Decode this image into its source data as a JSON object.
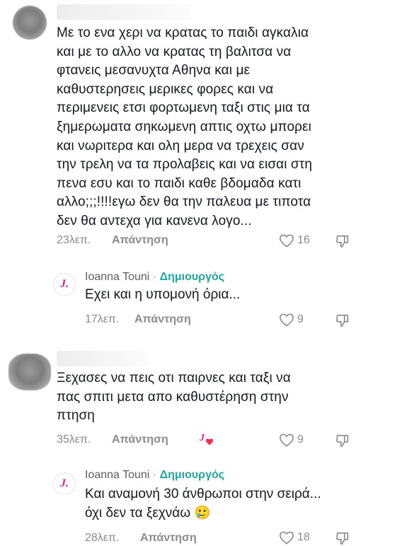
{
  "comments": [
    {
      "text": "Με το ενα χερι να κρατας το παιδι αγκαλια\nκαι με το αλλο να κρατας τη βαλιτσα να\nφτανεις μεσανυχτα Αθηνα και με\nκαθυστερησεις μερικες φορες και να\nπεριμενεις ετσι φορτωμενη ταξι στις μια τα\nξημερωματα σηκωμενη απτις οχτω μπορει\nκαι νωριτερα και ολη μερα να τρεχεις σαν\nτην τρελη να τα προλαβεις και να εισαι στη\nπενα εσυ και το παιδι καθε βδομαδα κατι\nαλλο;;;!!!!εγω δεν θα την παλευα με τιποτα\nδεν θα αντεχα για κανενα λογο...",
      "time": "23λεπ.",
      "reply_label": "Απάντηση",
      "likes": "16",
      "reply": {
        "avatar_letter": "J.",
        "author": "Ioanna Touni",
        "separator": "·",
        "badge": "Δημιουργός",
        "text": "Εχει και η υπομονή όρια...",
        "time": "17λεπ.",
        "reply_label": "Απάντηση",
        "likes": "9"
      }
    },
    {
      "text": "Ξεχασες να πεις οτι παιρνες και ταξι να\nπας σπιτι μετα απο καθυστέρηση στην\nπτηση",
      "time": "35λεπ.",
      "reply_label": "Απάντηση",
      "creator_liked_letter": "J",
      "likes": "9",
      "reply": {
        "avatar_letter": "J.",
        "author": "Ioanna Touni",
        "separator": "·",
        "badge": "Δημιουργός",
        "text": "Και αναμονή 30 άνθρωποι στην σειρά... \nόχι δεν τα ξεχνάω 🥲",
        "time": "28λεπ.",
        "reply_label": "Απάντηση",
        "likes": "18"
      }
    }
  ],
  "colors": {
    "accent_pink": "#e0218a",
    "creator_badge": "#20a7a0",
    "meta_gray": "#8a8b91"
  }
}
